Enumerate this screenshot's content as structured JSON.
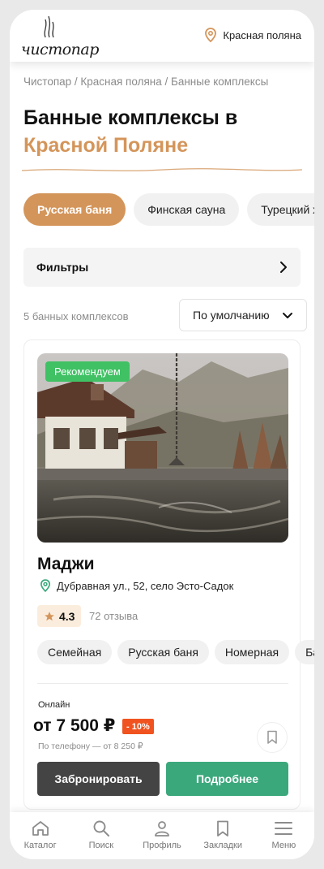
{
  "header": {
    "logo_text": "чистопар",
    "location_label": "Красная поляна"
  },
  "breadcrumb": "Чистопар / Красная поляна / Банные комплексы",
  "page_title": {
    "line1": "Банные комплексы в",
    "line2": "Красной Поляне"
  },
  "tabs": [
    {
      "label": "Русская баня",
      "active": true
    },
    {
      "label": "Финская сауна",
      "active": false
    },
    {
      "label": "Турецкий хамам",
      "active": false
    }
  ],
  "filters": {
    "label": "Фильтры"
  },
  "results": {
    "count_label": "5 банных комплексов",
    "sort_value": "По умолчанию"
  },
  "card": {
    "badge": "Рекомендуем",
    "name": "Маджи",
    "address": "Дубравная ул., 52, село Эсто-Садок",
    "rating": "4.3",
    "reviews": "72 отзыва",
    "tags": [
      "Семейная",
      "Русская баня",
      "Номерная",
      "Бассейн"
    ],
    "online_label": "Онлайн",
    "price": "от 7 500 ₽",
    "discount": "- 10%",
    "phone_price": "По телефону — от 8 250 ₽",
    "book_button": "Забронировать",
    "more_button": "Подробнее"
  },
  "bottom_nav": [
    {
      "label": "Каталог",
      "icon": "home-icon"
    },
    {
      "label": "Поиск",
      "icon": "search-icon"
    },
    {
      "label": "Профиль",
      "icon": "user-icon"
    },
    {
      "label": "Закладки",
      "icon": "bookmark-icon"
    },
    {
      "label": "Меню",
      "icon": "menu-icon"
    }
  ],
  "colors": {
    "accent": "#d4955a",
    "green": "#3ba87c",
    "badge_green": "#3fc164",
    "discount": "#f0531f",
    "dark_button": "#444444"
  }
}
